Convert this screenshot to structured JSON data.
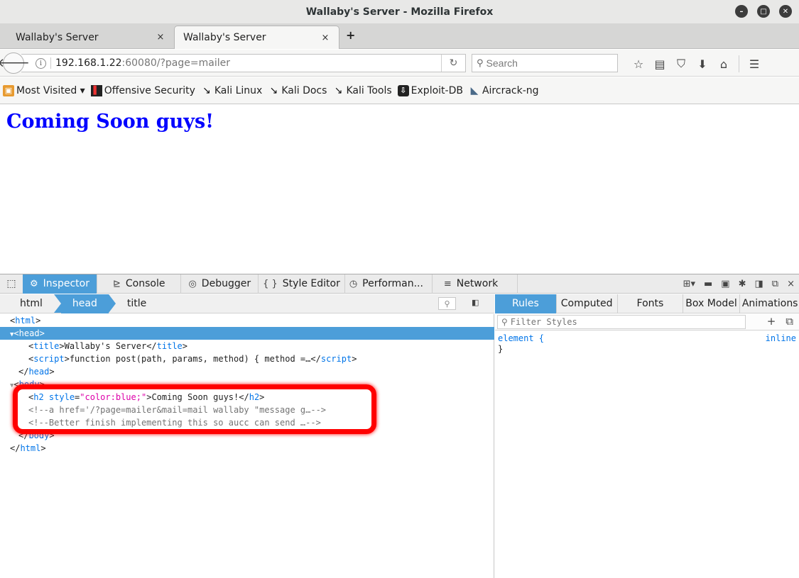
{
  "window": {
    "title": "Wallaby's Server - Mozilla Firefox"
  },
  "tabs": [
    {
      "label": "Wallaby's Server",
      "close": "×"
    },
    {
      "label": "Wallaby's Server",
      "close": "×"
    }
  ],
  "newtab": "+",
  "nav": {
    "url_host": "192.168.1.22",
    "url_rest": ":60080/?page=mailer",
    "search_placeholder": "Search"
  },
  "bookmarks": [
    {
      "label": "Most Visited ▾",
      "icon": "folder-icon"
    },
    {
      "label": "Offensive Security",
      "icon": "offsec-icon"
    },
    {
      "label": "Kali Linux",
      "icon": "kali-dragon-icon"
    },
    {
      "label": "Kali Docs",
      "icon": "kali-dragon-icon"
    },
    {
      "label": "Kali Tools",
      "icon": "kali-dragon-icon"
    },
    {
      "label": "Exploit-DB",
      "icon": "exploit-db-icon"
    },
    {
      "label": "Aircrack-ng",
      "icon": "aircrack-icon"
    }
  ],
  "page": {
    "heading": "Coming Soon guys!",
    "heading_color": "#0000ff"
  },
  "devtools": {
    "tabs": [
      {
        "label": "Inspector",
        "icon": "⚙"
      },
      {
        "label": "Console",
        "icon": "⊵"
      },
      {
        "label": "Debugger",
        "icon": "◎"
      },
      {
        "label": "Style Editor",
        "icon": "{ }"
      },
      {
        "label": "Performan...",
        "icon": "◷"
      },
      {
        "label": "Network",
        "icon": "≡"
      }
    ],
    "breadcrumbs": [
      "html",
      "head",
      "title"
    ],
    "side_tabs": [
      "Rules",
      "Computed",
      "Fonts",
      "Box Model",
      "Animations"
    ],
    "filter_placeholder": "Filter Styles",
    "rules": {
      "selector": "element {",
      "source": "inline",
      "close": "}"
    },
    "highlight_color": "#ff0000"
  },
  "markup": {
    "html_open": "html",
    "head_open": "head",
    "title_tag": "title",
    "title_text": "Wallaby's Server",
    "script_tag": "script",
    "script_text": "function post(path, params, method) { method =…",
    "head_close": "head",
    "body_open": "body",
    "h2_tag": "h2",
    "h2_attr": "style",
    "h2_attr_value": "\"color:blue;\"",
    "h2_text": "Coming Soon guys!",
    "comment1": "<!--a href='/?page=mailer&mail=mail wallaby \"message g…-->",
    "comment2": "<!--Better finish implementing this so aucc can send …-->",
    "body_close": "body",
    "html_close": "html"
  }
}
